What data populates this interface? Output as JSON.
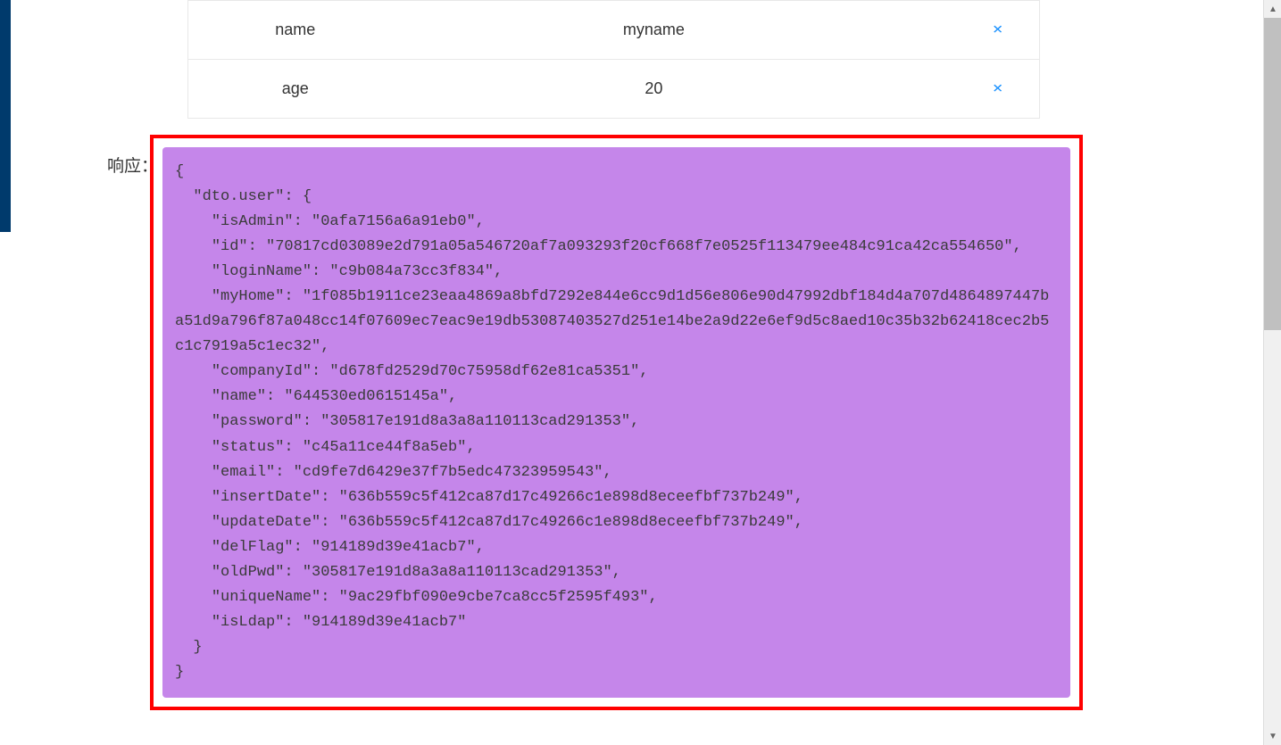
{
  "table": {
    "rows": [
      {
        "key": "name",
        "value": "myname"
      },
      {
        "key": "age",
        "value": "20"
      }
    ]
  },
  "response": {
    "label": "响应：",
    "json": "{\n  \"dto.user\": {\n    \"isAdmin\": \"0afa7156a6a91eb0\",\n    \"id\": \"70817cd03089e2d791a05a546720af7a093293f20cf668f7e0525f113479ee484c91ca42ca554650\",\n    \"loginName\": \"c9b084a73cc3f834\",\n    \"myHome\": \"1f085b1911ce23eaa4869a8bfd7292e844e6cc9d1d56e806e90d47992dbf184d4a707d4864897447ba51d9a796f87a048cc14f07609ec7eac9e19db53087403527d251e14be2a9d22e6ef9d5c8aed10c35b32b62418cec2b5c1c7919a5c1ec32\",\n    \"companyId\": \"d678fd2529d70c75958df62e81ca5351\",\n    \"name\": \"644530ed0615145a\",\n    \"password\": \"305817e191d8a3a8a110113cad291353\",\n    \"status\": \"c45a11ce44f8a5eb\",\n    \"email\": \"cd9fe7d6429e37f7b5edc47323959543\",\n    \"insertDate\": \"636b559c5f412ca87d17c49266c1e898d8eceefbf737b249\",\n    \"updateDate\": \"636b559c5f412ca87d17c49266c1e898d8eceefbf737b249\",\n    \"delFlag\": \"914189d39e41acb7\",\n    \"oldPwd\": \"305817e191d8a3a8a110113cad291353\",\n    \"uniqueName\": \"9ac29fbf090e9cbe7ca8cc5f2595f493\",\n    \"isLdap\": \"914189d39e41acb7\"\n  }\n}"
  }
}
